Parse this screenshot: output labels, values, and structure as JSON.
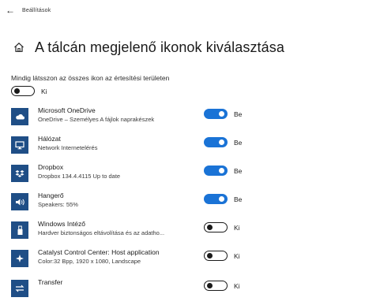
{
  "titlebar": {
    "back_glyph": "←",
    "app_name": "Beállítások"
  },
  "header": {
    "home_icon": "home-icon",
    "title": "A tálcán megjelenő ikonok kiválasztása"
  },
  "master": {
    "label": "Mindig látsszon az összes ikon az értesítési területen",
    "toggle_state": "Ki",
    "on": false
  },
  "accent_color": "#1a73d6",
  "icon_bg_color": "#1f4e86",
  "items": [
    {
      "title": "Microsoft OneDrive",
      "subtitle": "OneDrive – Személyes A fájlok naprakészek",
      "state": "Be",
      "on": true,
      "icon": "cloud-icon"
    },
    {
      "title": "Hálózat",
      "subtitle": "Network Internetelérés",
      "state": "Be",
      "on": true,
      "icon": "monitor-icon"
    },
    {
      "title": "Dropbox",
      "subtitle": "Dropbox 134.4.4115 Up to date",
      "state": "Be",
      "on": true,
      "icon": "dropbox-icon"
    },
    {
      "title": "Hangerő",
      "subtitle": "Speakers: 55%",
      "state": "Be",
      "on": true,
      "icon": "speaker-icon"
    },
    {
      "title": "Windows Intéző",
      "subtitle": "Hardver biztonságos eltávolítása és az adatho...",
      "state": "Ki",
      "on": false,
      "icon": "usb-icon"
    },
    {
      "title": "Catalyst Control Center: Host application",
      "subtitle": "Color:32 Bpp, 1920 x 1080, Landscape",
      "state": "Ki",
      "on": false,
      "icon": "catalyst-icon"
    },
    {
      "title": "Transfer",
      "subtitle": "",
      "state": "Ki",
      "on": false,
      "icon": "transfer-icon"
    }
  ]
}
